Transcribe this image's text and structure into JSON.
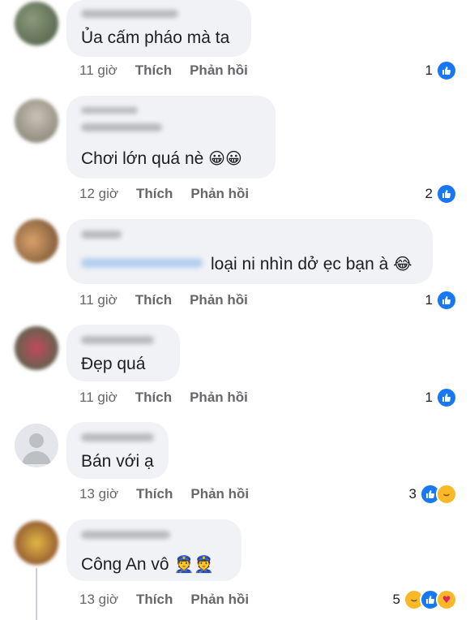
{
  "comments": [
    {
      "text": "Ủa cấm pháo mà ta",
      "time": "11 giờ",
      "like": "Thích",
      "reply": "Phản hồi",
      "count": "1"
    },
    {
      "text": "Chơi lớn quá nè",
      "emoji": "😀😀",
      "time": "12 giờ",
      "like": "Thích",
      "reply": "Phản hồi",
      "count": "2"
    },
    {
      "text": "loại ni nhìn dở ẹc bạn à",
      "emoji": "😂",
      "time": "11 giờ",
      "like": "Thích",
      "reply": "Phản hồi",
      "count": "1"
    },
    {
      "text": "Đẹp quá",
      "time": "11 giờ",
      "like": "Thích",
      "reply": "Phản hồi",
      "count": "1"
    },
    {
      "text": "Bán với ạ",
      "time": "13 giờ",
      "like": "Thích",
      "reply": "Phản hồi",
      "count": "3"
    },
    {
      "text": "Công An vô",
      "emoji": "👮👮",
      "time": "13 giờ",
      "like": "Thích",
      "reply": "Phản hồi",
      "count": "5"
    }
  ],
  "icons": {
    "like": "thumbs-up-icon",
    "haha": "laugh-icon",
    "care": "care-icon"
  },
  "colors": {
    "like": "#1877f2",
    "bubble": "#f0f2f5",
    "meta": "#65676b"
  }
}
